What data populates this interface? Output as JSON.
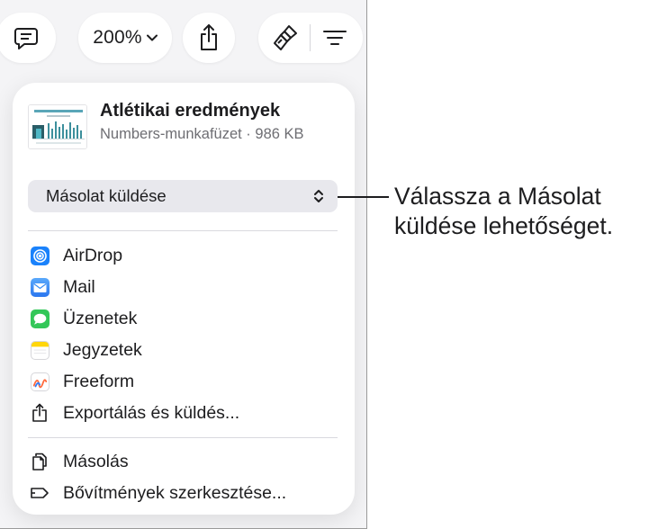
{
  "toolbar": {
    "zoom_value": "200%",
    "icons": [
      "comment-icon",
      "chevron-down-icon",
      "share-icon",
      "format-brush-icon",
      "organize-icon"
    ]
  },
  "popover": {
    "document": {
      "title": "Atlétikai eredmények",
      "meta": "Numbers-munkafüzet · 986 KB"
    },
    "send_option": {
      "selected": "Másolat küldése"
    },
    "share_targets": [
      {
        "label": "AirDrop",
        "icon": "airdrop-icon",
        "color": "#1a82fb"
      },
      {
        "label": "Mail",
        "icon": "mail-icon",
        "color": "#3b8ff6"
      },
      {
        "label": "Üzenetek",
        "icon": "messages-icon",
        "color": "#34c759"
      },
      {
        "label": "Jegyzetek",
        "icon": "notes-icon",
        "color": "#ffd60a"
      },
      {
        "label": "Freeform",
        "icon": "freeform-icon",
        "color": "#ffffff"
      },
      {
        "label": "Exportálás és küldés...",
        "icon": "export-icon"
      }
    ],
    "actions": [
      {
        "label": "Másolás",
        "icon": "copy-icon"
      },
      {
        "label": "Bővítmények szerkesztése...",
        "icon": "extensions-icon"
      }
    ]
  },
  "callout": {
    "text": "Válassza a Másolat küldése lehetőséget."
  }
}
